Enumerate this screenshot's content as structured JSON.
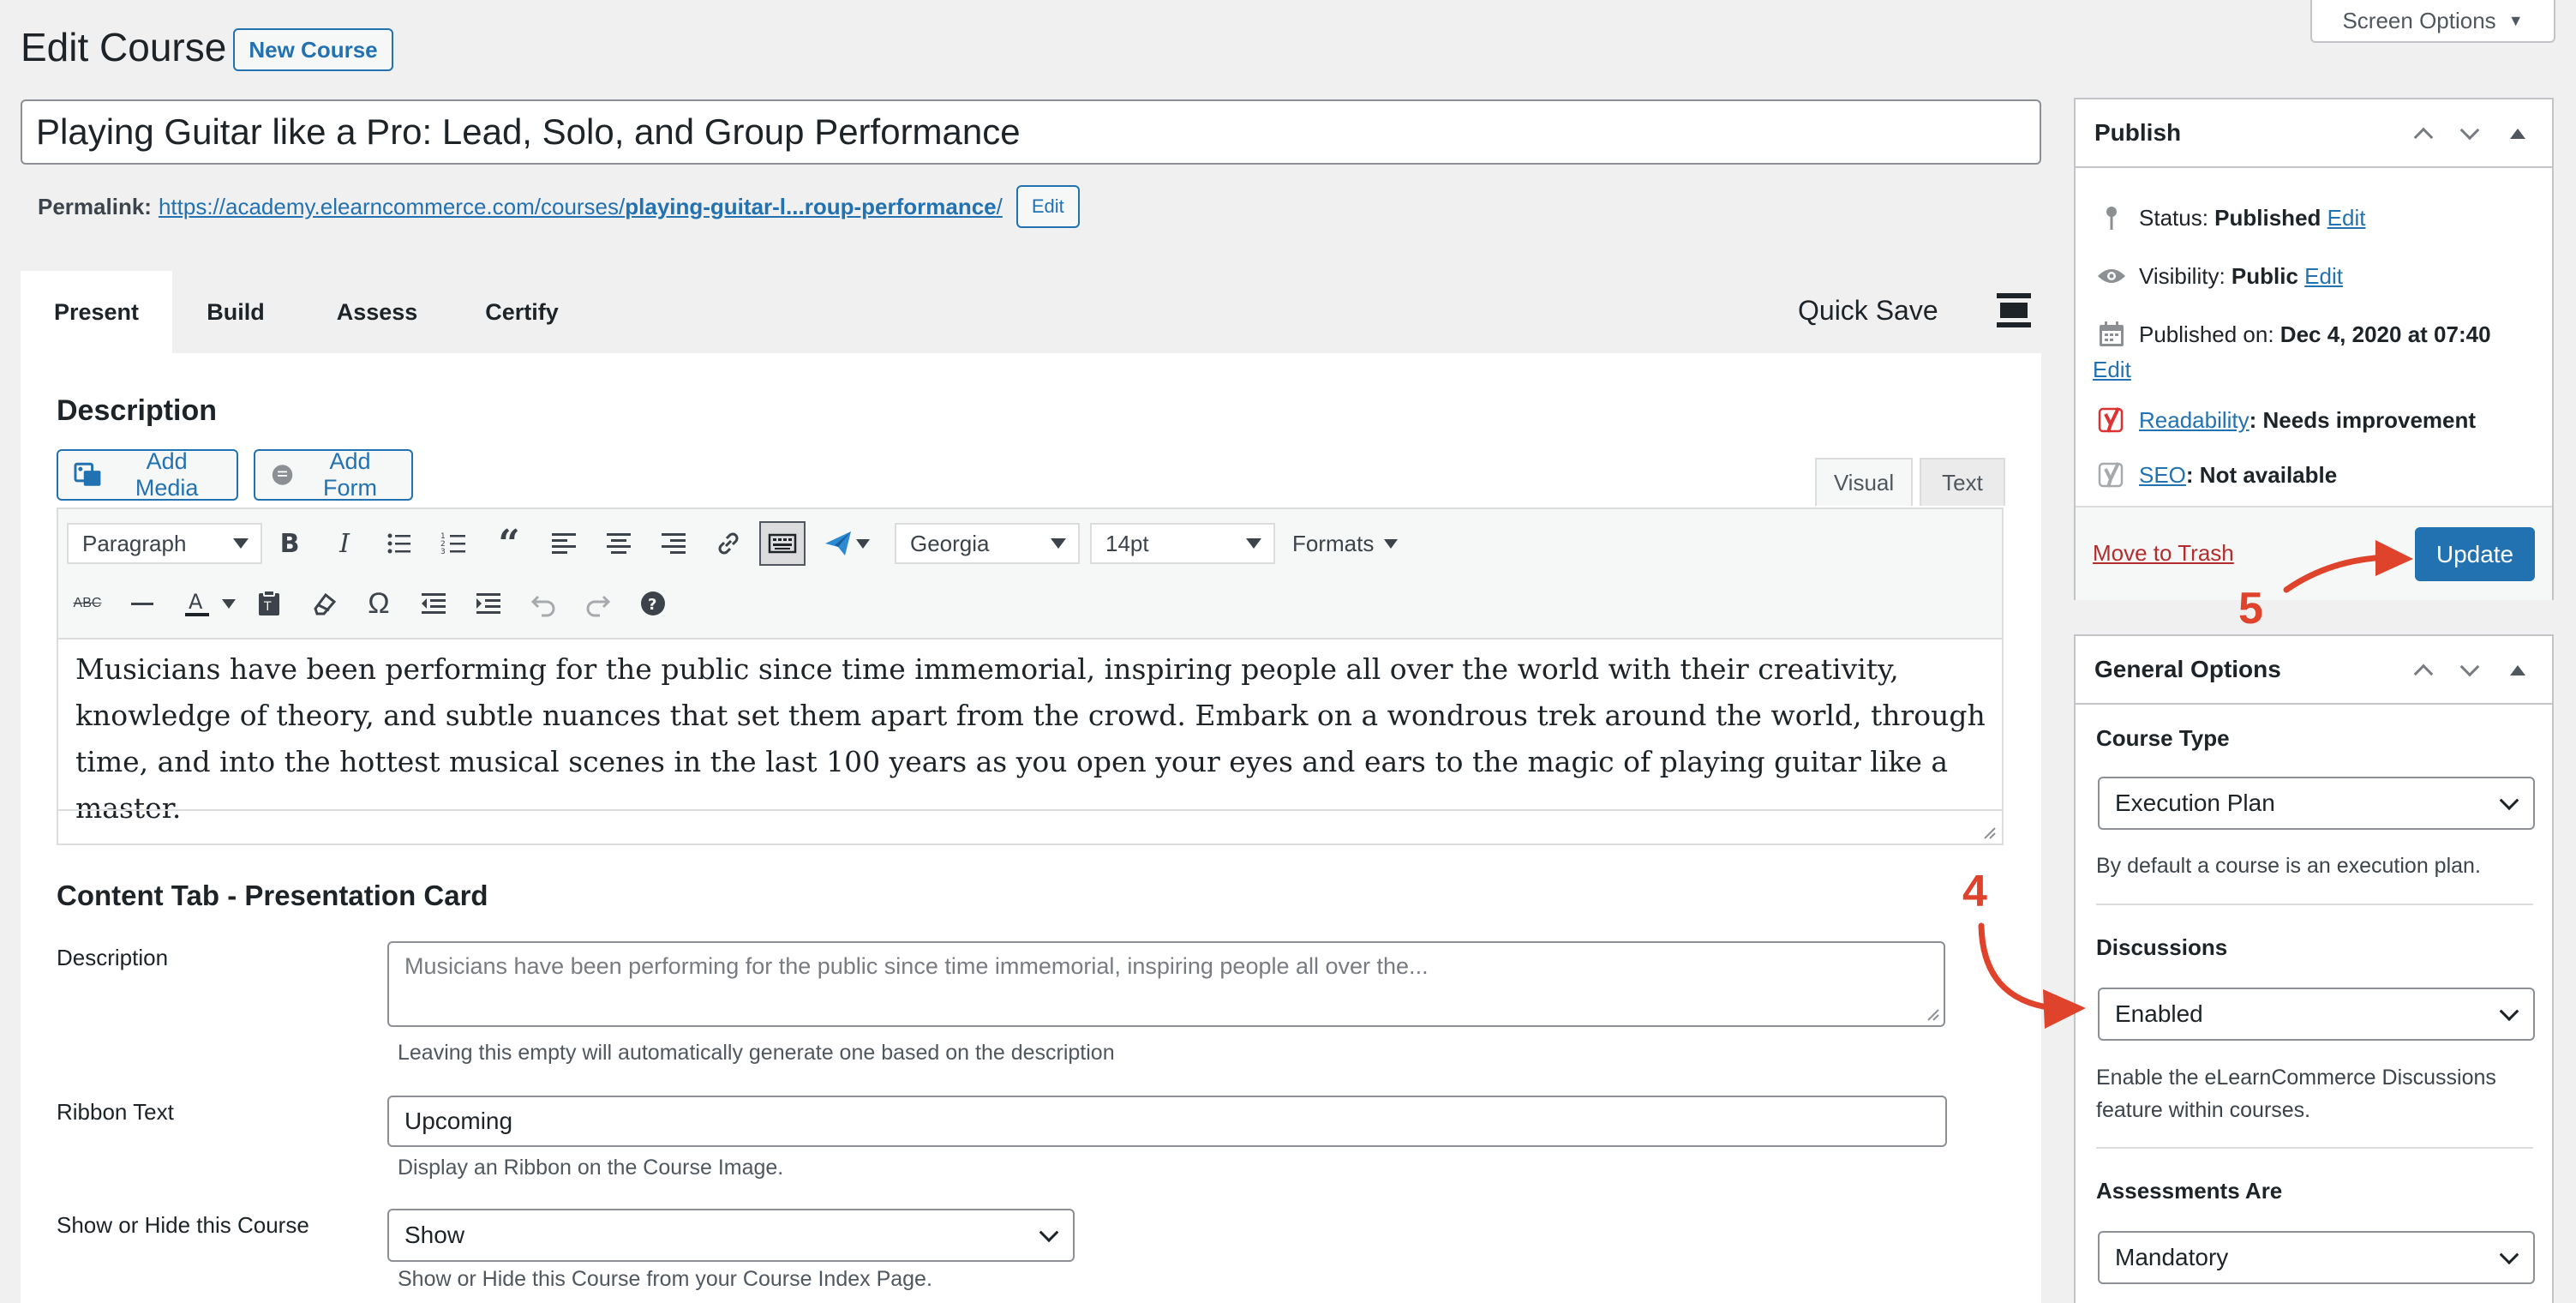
{
  "screen_options": {
    "label": "Screen Options"
  },
  "header": {
    "title": "Edit Course",
    "new_button": "New Course"
  },
  "post_title": "Playing Guitar like a Pro: Lead, Solo, and Group Performance",
  "permalink": {
    "label": "Permalink:",
    "url_base": "https://academy.elearncommerce.com/courses/",
    "slug": "playing-guitar-l...roup-performance",
    "trailing": "/",
    "edit": "Edit"
  },
  "tabs": [
    {
      "label": "Present"
    },
    {
      "label": "Build"
    },
    {
      "label": "Assess"
    },
    {
      "label": "Certify"
    }
  ],
  "quick_save": "Quick Save",
  "description_section": {
    "heading": "Description",
    "add_media": "Add Media",
    "add_form": "Add Form",
    "visual_tab": "Visual",
    "text_tab": "Text",
    "format_select": "Paragraph",
    "font_select": "Georgia",
    "size_select": "14pt",
    "formats_menu": "Formats",
    "strikethrough_icon_text": "ABC",
    "body": "Musicians have been performing for the public since time immemorial, inspiring people all over the world with their creativity, knowledge of theory, and subtle nuances that set them apart from the crowd. Embark on a wondrous trek around the world, through time, and into the hottest musical scenes in the last 100 years as you open your eyes and ears to the magic of playing guitar like a master."
  },
  "presentation_card": {
    "heading": "Content Tab - Presentation Card",
    "description_label": "Description",
    "description_placeholder": "Musicians have been performing for the public since time immemorial, inspiring people all over the...",
    "description_help": "Leaving this empty will automatically generate one based on the description",
    "ribbon_label": "Ribbon Text",
    "ribbon_value": "Upcoming",
    "ribbon_help": "Display an Ribbon on the Course Image.",
    "visibility_label": "Show or Hide this Course",
    "visibility_value": "Show",
    "visibility_help": "Show or Hide this Course from your Course Index Page."
  },
  "publish_box": {
    "title": "Publish",
    "status_label": "Status:",
    "status_value": "Published",
    "visibility_label": "Visibility:",
    "visibility_value": "Public",
    "published_label": "Published on:",
    "published_value": "Dec 4, 2020 at 07:40",
    "edit": "Edit",
    "readability_label": "Readability",
    "readability_value": ": Needs improvement",
    "seo_label": "SEO",
    "seo_value": ": Not available",
    "trash": "Move to Trash",
    "update": "Update"
  },
  "general_options": {
    "title": "General Options",
    "course_type_label": "Course Type",
    "course_type_value": "Execution Plan",
    "course_type_help": "By default a course is an execution plan.",
    "discussions_label": "Discussions",
    "discussions_value": "Enabled",
    "discussions_help_line1": "Enable the eLearnCommerce Discussions",
    "discussions_help_line2": "feature within courses.",
    "assessments_label": "Assessments Are",
    "assessments_value": "Mandatory"
  },
  "annotations": {
    "step4": "4",
    "step5": "5",
    "color": "#e0432b"
  },
  "colors": {
    "accent": "#2271b1",
    "trash": "#b32d2e",
    "yoast": "#a4286a"
  }
}
